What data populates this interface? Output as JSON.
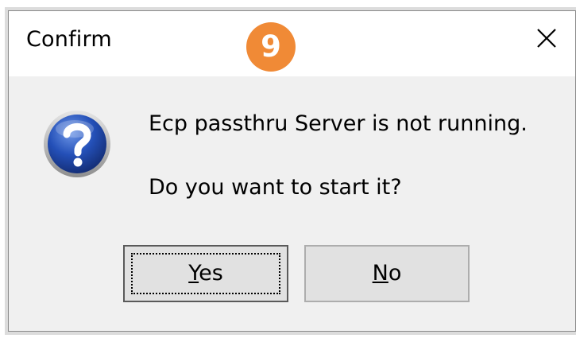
{
  "dialog": {
    "title": "Confirm",
    "close_icon": "close-icon",
    "step_badge": "9",
    "step_badge_color": "#f08a36",
    "icon": "question-icon",
    "message_line1": "Ecp passthru Server is not running.",
    "message_line2": "Do you want to start it?",
    "buttons": {
      "yes": {
        "accel": "Y",
        "rest": "es"
      },
      "no": {
        "accel": "N",
        "rest": "o"
      }
    }
  }
}
